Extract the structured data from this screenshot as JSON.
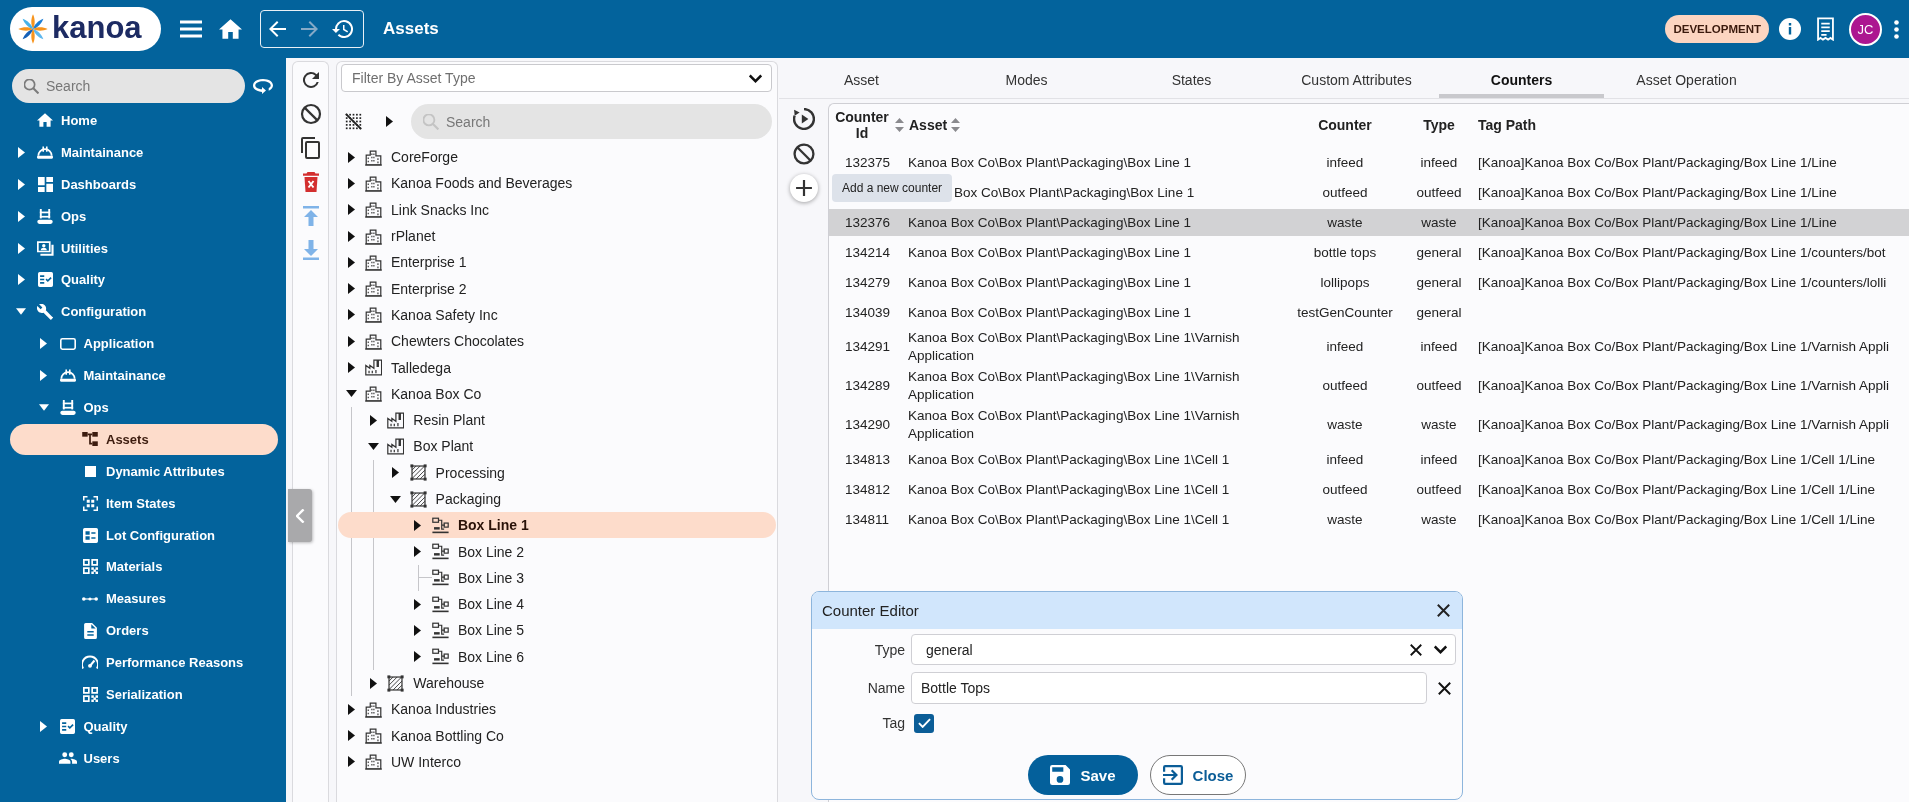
{
  "app_bar": {
    "logo_text": "kanoa",
    "nav_buttons": [
      {
        "disabled": false
      },
      {
        "disabled": true
      },
      {
        "disabled": false
      }
    ],
    "title": "Assets",
    "environment_badge": "DEVELOPMENT",
    "avatar_initials": "JC"
  },
  "sidebar": {
    "search": {
      "placeholder": "Search"
    },
    "items": [
      {
        "label": "Home",
        "expandable": false,
        "expanded": false,
        "selected": false
      },
      {
        "label": "Maintainance",
        "expandable": true,
        "expanded": false,
        "selected": false
      },
      {
        "label": "Dashboards",
        "expandable": true,
        "expanded": false,
        "selected": false
      },
      {
        "label": "Ops",
        "expandable": true,
        "expanded": false,
        "selected": false
      },
      {
        "label": "Utilities",
        "expandable": true,
        "expanded": false,
        "selected": false
      },
      {
        "label": "Quality",
        "expandable": true,
        "expanded": false,
        "selected": false
      },
      {
        "label": "Configuration",
        "expandable": true,
        "expanded": true,
        "selected": false,
        "children": [
          {
            "label": "Application",
            "expandable": true,
            "expanded": false,
            "selected": false
          },
          {
            "label": "Maintainance",
            "expandable": true,
            "expanded": false,
            "selected": false
          },
          {
            "label": "Ops",
            "expandable": true,
            "expanded": true,
            "selected": false,
            "children": [
              {
                "label": "Assets",
                "expandable": false,
                "expanded": false,
                "selected": true
              },
              {
                "label": "Dynamic Attributes",
                "expandable": false,
                "expanded": false,
                "selected": false
              },
              {
                "label": "Item States",
                "expandable": false,
                "expanded": false,
                "selected": false
              },
              {
                "label": "Lot Configuration",
                "expandable": false,
                "expanded": false,
                "selected": false
              },
              {
                "label": "Materials",
                "expandable": false,
                "expanded": false,
                "selected": false
              },
              {
                "label": "Measures",
                "expandable": false,
                "expanded": false,
                "selected": false
              },
              {
                "label": "Orders",
                "expandable": false,
                "expanded": false,
                "selected": false
              },
              {
                "label": "Performance Reasons",
                "expandable": false,
                "expanded": false,
                "selected": false
              },
              {
                "label": "Serialization",
                "expandable": false,
                "expanded": false,
                "selected": false
              }
            ]
          },
          {
            "label": "Quality",
            "expandable": true,
            "expanded": false,
            "selected": false
          },
          {
            "label": "Users",
            "expandable": false,
            "expanded": false,
            "selected": false
          }
        ]
      }
    ]
  },
  "tree_toolbar": [
    {
      "disabled": false
    },
    {
      "disabled": false
    },
    {
      "disabled": false
    },
    {
      "disabled": false
    },
    {
      "disabled": true
    },
    {
      "disabled": true
    }
  ],
  "asset_tree": {
    "filter": {
      "placeholder": "Filter By Asset Type"
    },
    "search": {
      "placeholder": "Search"
    },
    "nodes": [
      {
        "label": "CoreForge",
        "kind": "enterprise",
        "expandable": true,
        "expanded": false,
        "selected": false
      },
      {
        "label": "Kanoa Foods and Beverages",
        "kind": "enterprise",
        "expandable": true,
        "expanded": false,
        "selected": false
      },
      {
        "label": "Link Snacks Inc",
        "kind": "enterprise",
        "expandable": true,
        "expanded": false,
        "selected": false
      },
      {
        "label": "rPlanet",
        "kind": "enterprise",
        "expandable": true,
        "expanded": false,
        "selected": false
      },
      {
        "label": "Enterprise 1",
        "kind": "enterprise",
        "expandable": true,
        "expanded": false,
        "selected": false
      },
      {
        "label": "Enterprise 2",
        "kind": "enterprise",
        "expandable": true,
        "expanded": false,
        "selected": false
      },
      {
        "label": "Kanoa Safety Inc",
        "kind": "enterprise",
        "expandable": true,
        "expanded": false,
        "selected": false
      },
      {
        "label": "Chewters Chocolates",
        "kind": "enterprise",
        "expandable": true,
        "expanded": false,
        "selected": false
      },
      {
        "label": "Talledega",
        "kind": "site",
        "expandable": true,
        "expanded": false,
        "selected": false
      },
      {
        "label": "Kanoa Box Co",
        "kind": "enterprise",
        "expandable": true,
        "expanded": true,
        "selected": false,
        "children": [
          {
            "label": "Resin Plant",
            "kind": "site",
            "expandable": true,
            "expanded": false,
            "selected": false
          },
          {
            "label": "Box Plant",
            "kind": "site",
            "expandable": true,
            "expanded": true,
            "selected": false,
            "children": [
              {
                "label": "Processing",
                "kind": "area",
                "expandable": true,
                "expanded": false,
                "selected": false
              },
              {
                "label": "Packaging",
                "kind": "area",
                "expandable": true,
                "expanded": true,
                "selected": false,
                "children": [
                  {
                    "label": "Box Line 1",
                    "kind": "line",
                    "expandable": true,
                    "expanded": false,
                    "selected": true
                  },
                  {
                    "label": "Box Line 2",
                    "kind": "line",
                    "expandable": true,
                    "expanded": false,
                    "selected": false
                  },
                  {
                    "label": "Box Line 3",
                    "kind": "line",
                    "expandable": false,
                    "expanded": false,
                    "selected": false
                  },
                  {
                    "label": "Box Line 4",
                    "kind": "line",
                    "expandable": true,
                    "expanded": false,
                    "selected": false
                  },
                  {
                    "label": "Box Line 5",
                    "kind": "line",
                    "expandable": true,
                    "expanded": false,
                    "selected": false
                  },
                  {
                    "label": "Box Line 6",
                    "kind": "line",
                    "expandable": true,
                    "expanded": false,
                    "selected": false
                  }
                ]
              }
            ]
          },
          {
            "label": "Warehouse",
            "kind": "area",
            "expandable": true,
            "expanded": false,
            "selected": false
          }
        ]
      },
      {
        "label": "Kanoa Industries",
        "kind": "enterprise",
        "expandable": true,
        "expanded": false,
        "selected": false
      },
      {
        "label": "Kanoa Bottling Co",
        "kind": "enterprise",
        "expandable": true,
        "expanded": false,
        "selected": false
      },
      {
        "label": "UW Interco",
        "kind": "enterprise",
        "expandable": true,
        "expanded": false,
        "selected": false
      }
    ]
  },
  "tabs": [
    {
      "label": "Asset",
      "selected": false
    },
    {
      "label": "Modes",
      "selected": false
    },
    {
      "label": "States",
      "selected": false
    },
    {
      "label": "Custom Attributes",
      "selected": false
    },
    {
      "label": "Counters",
      "selected": true
    },
    {
      "label": "Asset Operation",
      "selected": false
    }
  ],
  "counters_table": {
    "add_tooltip": "Add a new counter",
    "columns": [
      {
        "label": "Counter Id",
        "sortable": true
      },
      {
        "label": "Asset",
        "sortable": true
      },
      {
        "label": "Counter",
        "sortable": false
      },
      {
        "label": "Type",
        "sortable": false
      },
      {
        "label": "Tag Path",
        "sortable": false
      }
    ],
    "rows": [
      {
        "counter_id": "132375",
        "asset": "Kanoa Box Co\\Box Plant\\Packaging\\Box Line 1",
        "counter": "infeed",
        "type": "infeed",
        "tag_path": "[Kanoa]Kanoa Box Co/Box Plant/Packaging/Box Line 1/Line",
        "selected": false
      },
      {
        "asset": "Box Co\\Box Plant\\Packaging\\Box Line 1",
        "counter": "outfeed",
        "type": "outfeed",
        "tag_path": "[Kanoa]Kanoa Box Co/Box Plant/Packaging/Box Line 1/Line",
        "selected": false
      },
      {
        "counter_id": "132376",
        "asset": "Kanoa Box Co\\Box Plant\\Packaging\\Box Line 1",
        "counter": "waste",
        "type": "waste",
        "tag_path": "[Kanoa]Kanoa Box Co/Box Plant/Packaging/Box Line 1/Line",
        "selected": true
      },
      {
        "counter_id": "134214",
        "asset": "Kanoa Box Co\\Box Plant\\Packaging\\Box Line 1",
        "counter": "bottle tops",
        "type": "general",
        "tag_path": "[Kanoa]Kanoa Box Co/Box Plant/Packaging/Box Line 1/counters/bot",
        "selected": false
      },
      {
        "counter_id": "134279",
        "asset": "Kanoa Box Co\\Box Plant\\Packaging\\Box Line 1",
        "counter": "lollipops",
        "type": "general",
        "tag_path": "[Kanoa]Kanoa Box Co/Box Plant/Packaging/Box Line 1/counters/lolli",
        "selected": false
      },
      {
        "counter_id": "134039",
        "asset": "Kanoa Box Co\\Box Plant\\Packaging\\Box Line 1",
        "counter": "testGenCounter",
        "type": "general",
        "selected": false
      },
      {
        "counter_id": "134291",
        "asset": "Kanoa Box Co\\Box Plant\\Packaging\\Box Line 1\\Varnish Application",
        "counter": "infeed",
        "type": "infeed",
        "tag_path": "[Kanoa]Kanoa Box Co/Box Plant/Packaging/Box Line 1/Varnish Appli",
        "selected": false
      },
      {
        "counter_id": "134289",
        "asset": "Kanoa Box Co\\Box Plant\\Packaging\\Box Line 1\\Varnish Application",
        "counter": "outfeed",
        "type": "outfeed",
        "tag_path": "[Kanoa]Kanoa Box Co/Box Plant/Packaging/Box Line 1/Varnish Appli",
        "selected": false
      },
      {
        "counter_id": "134290",
        "asset": "Kanoa Box Co\\Box Plant\\Packaging\\Box Line 1\\Varnish Application",
        "counter": "waste",
        "type": "waste",
        "tag_path": "[Kanoa]Kanoa Box Co/Box Plant/Packaging/Box Line 1/Varnish Appli",
        "selected": false
      },
      {
        "counter_id": "134813",
        "asset": "Kanoa Box Co\\Box Plant\\Packaging\\Box Line 1\\Cell 1",
        "counter": "infeed",
        "type": "infeed",
        "tag_path": "[Kanoa]Kanoa Box Co/Box Plant/Packaging/Box Line 1/Cell 1/Line",
        "selected": false
      },
      {
        "counter_id": "134812",
        "asset": "Kanoa Box Co\\Box Plant\\Packaging\\Box Line 1\\Cell 1",
        "counter": "outfeed",
        "type": "outfeed",
        "tag_path": "[Kanoa]Kanoa Box Co/Box Plant/Packaging/Box Line 1/Cell 1/Line",
        "selected": false
      },
      {
        "counter_id": "134811",
        "asset": "Kanoa Box Co\\Box Plant\\Packaging\\Box Line 1\\Cell 1",
        "counter": "waste",
        "type": "waste",
        "tag_path": "[Kanoa]Kanoa Box Co/Box Plant/Packaging/Box Line 1/Cell 1/Line",
        "selected": false
      }
    ]
  },
  "counter_editor": {
    "title": "Counter Editor",
    "fields": [
      {
        "kind": "select",
        "label": "Type",
        "value": "general"
      },
      {
        "kind": "text",
        "label": "Name",
        "value": "Bottle Tops"
      },
      {
        "kind": "checkbox",
        "label": "Tag",
        "checked": true
      }
    ],
    "buttons": [
      {
        "kind": "primary",
        "label": "Save"
      },
      {
        "kind": "secondary",
        "label": "Close"
      }
    ]
  }
}
